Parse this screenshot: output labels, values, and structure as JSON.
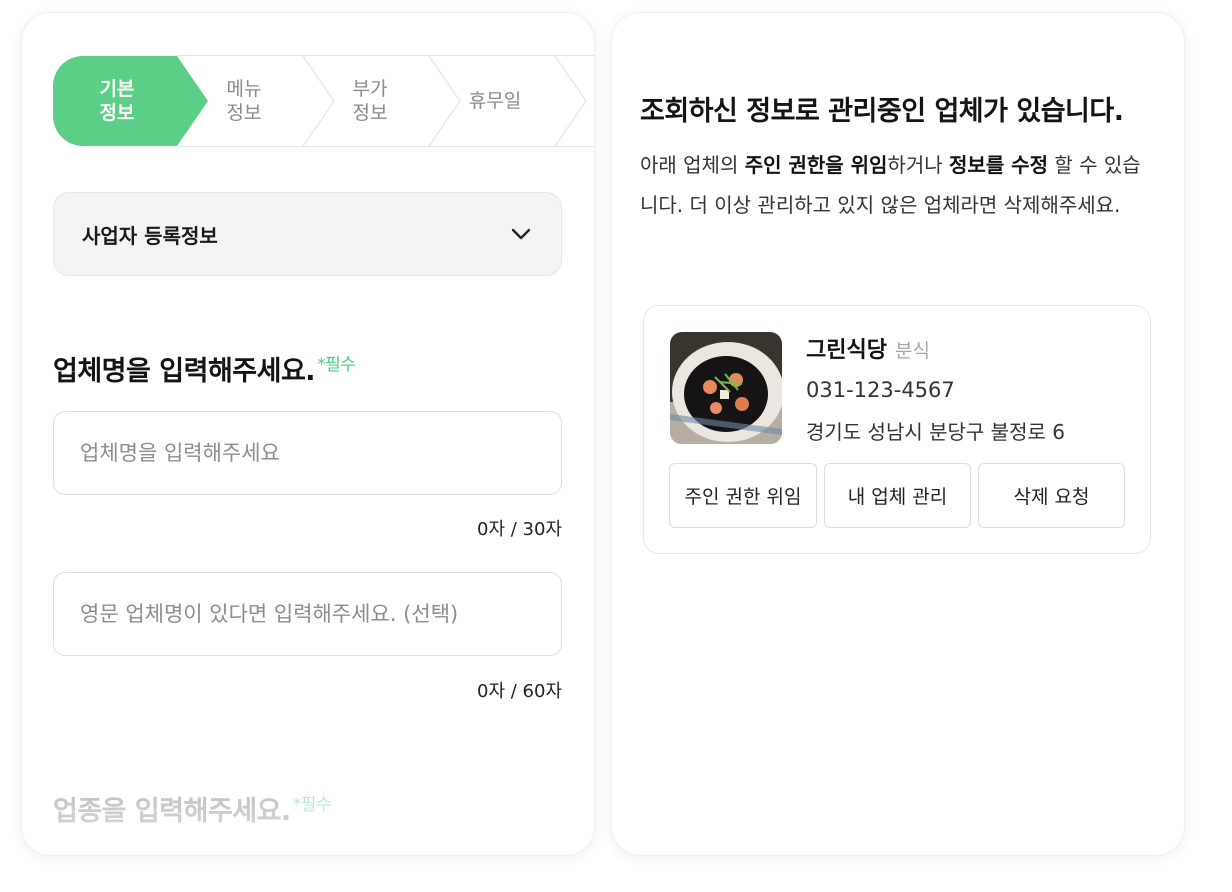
{
  "stepper": {
    "steps": [
      {
        "label": "기본\n정보",
        "active": true
      },
      {
        "label": "메뉴\n정보",
        "active": false
      },
      {
        "label": "부가\n정보",
        "active": false
      },
      {
        "label": "휴무일",
        "active": false
      }
    ]
  },
  "accordion": {
    "title": "사업자 등록정보",
    "icon": "chevron-down-icon"
  },
  "business_name": {
    "title": "업체명을 입력해주세요.",
    "required": "*필수",
    "placeholder": "업체명을 입력해주세요",
    "value": "",
    "counter": "0자 / 30자"
  },
  "english_name": {
    "placeholder": "영문 업체명이 있다면 입력해주세요. (선택)",
    "value": "",
    "counter": "0자 / 60자"
  },
  "category": {
    "title": "업종을 입력해주세요.",
    "required": "*필수"
  },
  "notice": {
    "title": "조회하신 정보로 관리중인 업체가 있습니다.",
    "body_1": "아래 업체의 ",
    "bold_1": "주인 권한을 위임",
    "body_2": "하거나 ",
    "bold_2": "정보를 수정",
    "body_3": " 할 수 있습니다. 더 이상 관리하고 있지 않은 업체라면 삭제해주세요."
  },
  "business_card": {
    "name": "그린식당",
    "category": "분식",
    "phone": "031-123-4567",
    "address": "경기도 성남시 분당구 불정로 6",
    "buttons": {
      "transfer": "주인 권한 위임",
      "manage": "내 업체 관리",
      "delete": "삭제 요청"
    }
  },
  "colors": {
    "accent": "#5ccf86",
    "required": "#4cc97f"
  }
}
